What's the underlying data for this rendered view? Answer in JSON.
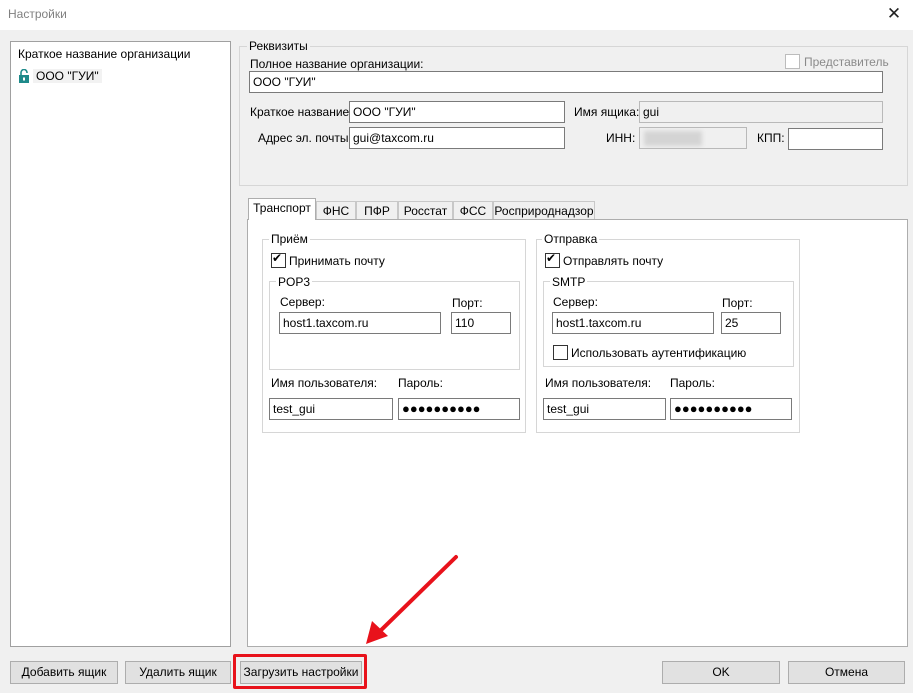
{
  "window": {
    "title": "Настройки",
    "close_glyph": "✕"
  },
  "tree": {
    "header": "Краткое название организации",
    "nodes": [
      {
        "label": "ООО \"ГУИ\"",
        "icon": "unlocked-padlock-icon"
      }
    ]
  },
  "requisites": {
    "group_label": "Реквизиты",
    "representative_label": "Представитель",
    "representative_checked": false,
    "full_name_label": "Полное название организации:",
    "full_name_value": "ООО \"ГУИ\"",
    "short_name_label": "Краткое название:",
    "short_name_value": "ООО \"ГУИ\"",
    "mailbox_label": "Имя ящика:",
    "mailbox_value": "gui",
    "email_label": "Адрес эл. почты:",
    "email_value": "gui@taxcom.ru",
    "inn_label": "ИНН:",
    "kpp_label": "КПП:",
    "kpp_value": ""
  },
  "tabs": [
    "Транспорт",
    "ФНС",
    "ПФР",
    "Росстат",
    "ФСС",
    "Росприроднадзор"
  ],
  "active_tab": "Транспорт",
  "receive": {
    "group_label": "Приём",
    "enable_label": "Принимать почту",
    "enable_checked": true,
    "protocol_label": "POP3",
    "server_label": "Сервер:",
    "server_value": "host1.taxcom.ru",
    "port_label": "Порт:",
    "port_value": "110",
    "user_label": "Имя пользователя:",
    "user_value": "test_gui",
    "password_label": "Пароль:",
    "password_mask": "●●●●●●●●●●"
  },
  "send": {
    "group_label": "Отправка",
    "enable_label": "Отправлять почту",
    "enable_checked": true,
    "protocol_label": "SMTP",
    "server_label": "Сервер:",
    "server_value": "host1.taxcom.ru",
    "port_label": "Порт:",
    "port_value": "25",
    "auth_label": "Использовать аутентификацию",
    "auth_checked": false,
    "user_label": "Имя пользователя:",
    "user_value": "test_gui",
    "password_label": "Пароль:",
    "password_mask": "●●●●●●●●●●"
  },
  "buttons": {
    "add_mailbox": "Добавить ящик",
    "delete_mailbox": "Удалить ящик",
    "load_settings": "Загрузить настройки",
    "ok": "OK",
    "cancel": "Отмена"
  },
  "annotation": {
    "highlight_color": "#e8121b",
    "target": "load-settings-button"
  }
}
